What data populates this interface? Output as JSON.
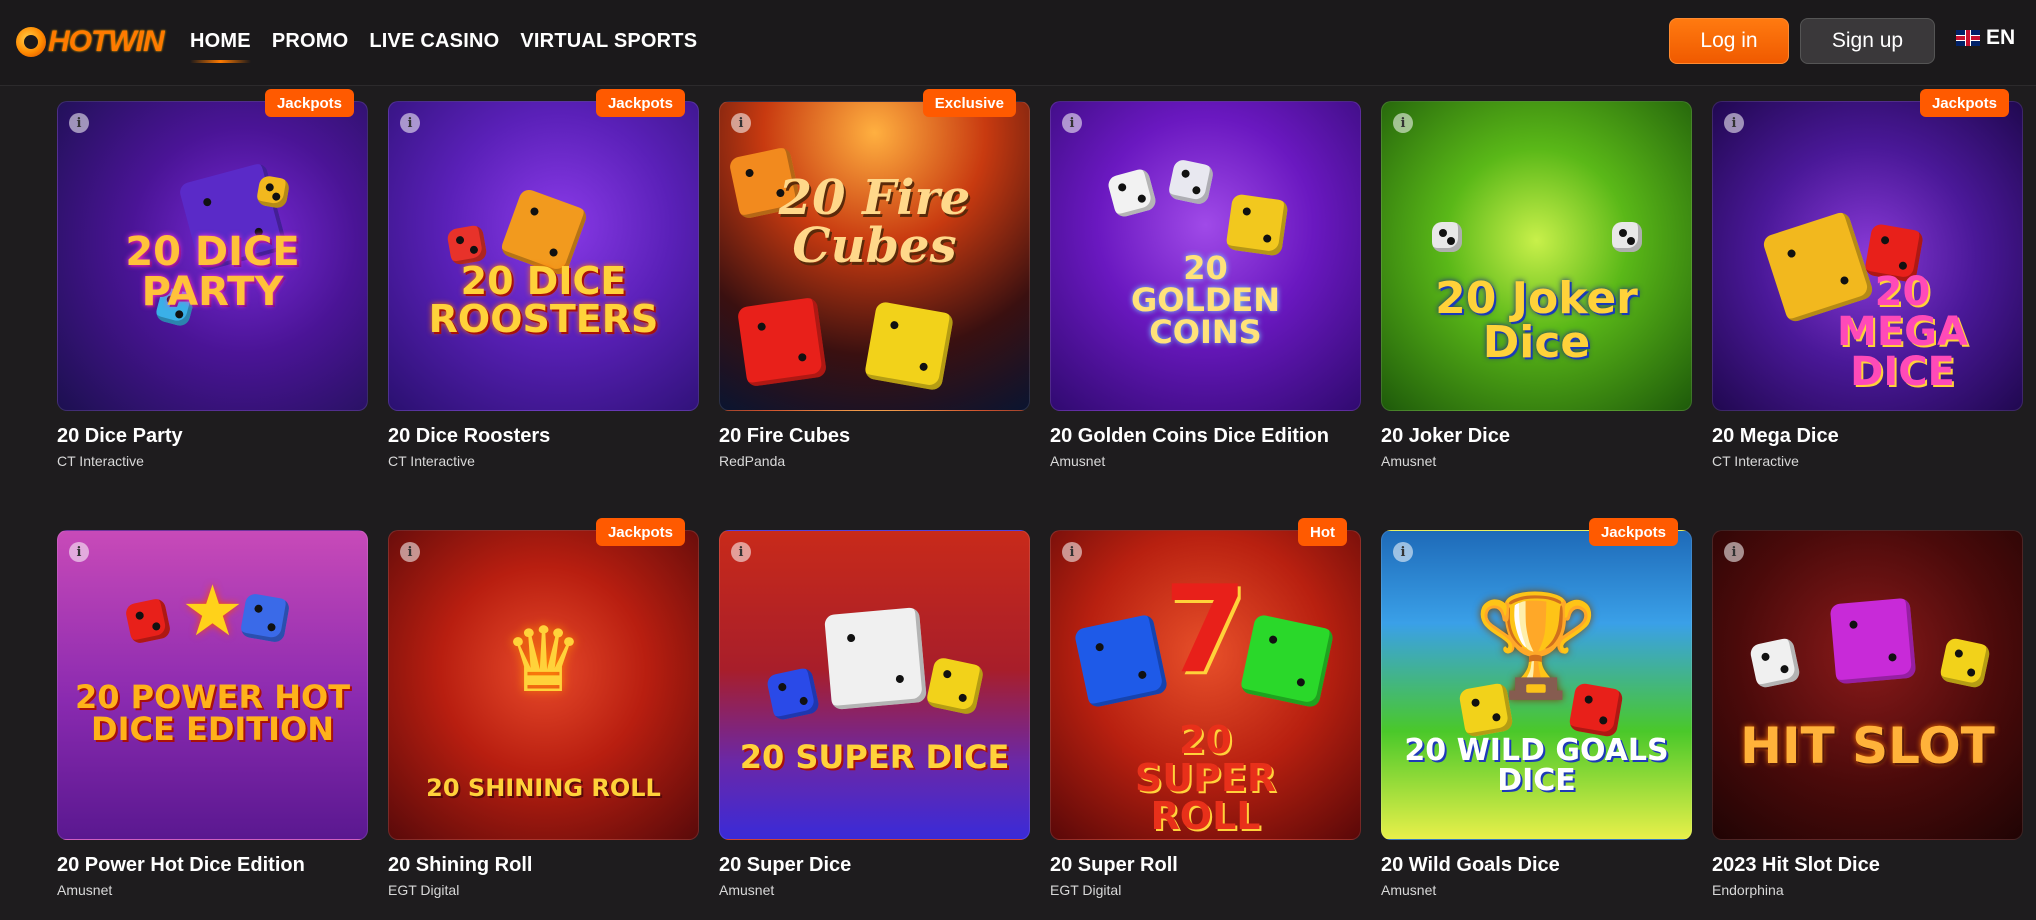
{
  "header": {
    "logo_text": "HOTWIN",
    "nav": [
      "HOME",
      "PROMO",
      "LIVE CASINO",
      "VIRTUAL SPORTS"
    ],
    "login_label": "Log in",
    "signup_label": "Sign up",
    "language": "EN"
  },
  "games": [
    {
      "title": "20 Dice Party",
      "provider": "CT Interactive",
      "badge": "Jackpots",
      "art": "20 DICE PARTY"
    },
    {
      "title": "20 Dice Roosters",
      "provider": "CT Interactive",
      "badge": "Jackpots",
      "art": "20 DICE ROOSTERS"
    },
    {
      "title": "20 Fire Cubes",
      "provider": "RedPanda",
      "badge": "Exclusive",
      "art": "20 Fire Cubes"
    },
    {
      "title": "20 Golden Coins Dice Edition",
      "provider": "Amusnet",
      "badge": "",
      "art": "20 GOLDEN COINS"
    },
    {
      "title": "20 Joker Dice",
      "provider": "Amusnet",
      "badge": "",
      "art": "20 Joker Dice"
    },
    {
      "title": "20 Mega Dice",
      "provider": "CT Interactive",
      "badge": "Jackpots",
      "art": "20 MEGA DICE"
    },
    {
      "title": "20 Power Hot Dice Edition",
      "provider": "Amusnet",
      "badge": "",
      "art": "20 POWER HOT DICE EDITION"
    },
    {
      "title": "20 Shining Roll",
      "provider": "EGT Digital",
      "badge": "Jackpots",
      "art": "20 SHINING ROLL"
    },
    {
      "title": "20 Super Dice",
      "provider": "Amusnet",
      "badge": "",
      "art": "20 SUPER DICE"
    },
    {
      "title": "20 Super Roll",
      "provider": "EGT Digital",
      "badge": "Hot",
      "art": "20 SUPER ROLL"
    },
    {
      "title": "20 Wild Goals Dice",
      "provider": "Amusnet",
      "badge": "Jackpots",
      "art": "20 WILD GOALS DICE"
    },
    {
      "title": "2023 Hit Slot Dice",
      "provider": "Endorphina",
      "badge": "",
      "art": "HIT SLOT"
    }
  ],
  "info_glyph": "i",
  "colors": {
    "accent": "#ff5a00",
    "background": "#1e1c1e"
  }
}
